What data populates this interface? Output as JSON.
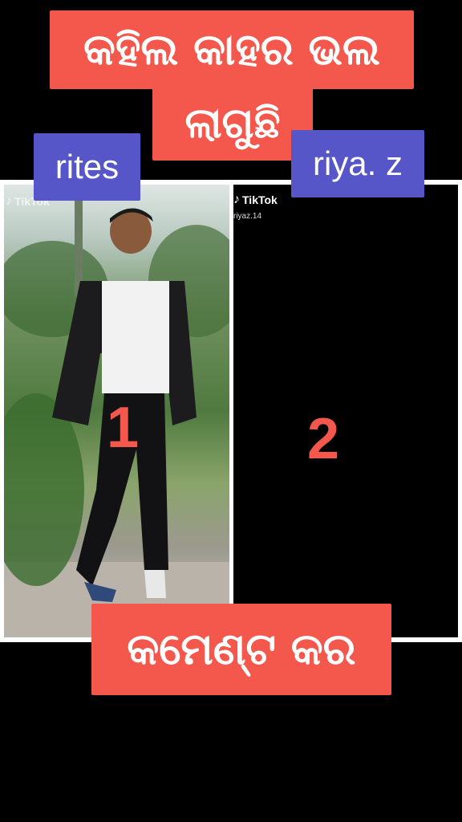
{
  "title": {
    "line1": "କହିଲ କାହର ଭଲ",
    "line2": "ଲାଗୁଛି"
  },
  "left": {
    "name": "rites",
    "watermark": "TikTok",
    "number": "1"
  },
  "right": {
    "name": "riya. z",
    "watermark": "TikTok",
    "handle": "riyaz.14",
    "number": "2"
  },
  "footer": {
    "text": "କମେଣ୍ଟ କର"
  },
  "colors": {
    "banner": "#f4574b",
    "name_tag": "#5656c9",
    "background": "#000000"
  }
}
